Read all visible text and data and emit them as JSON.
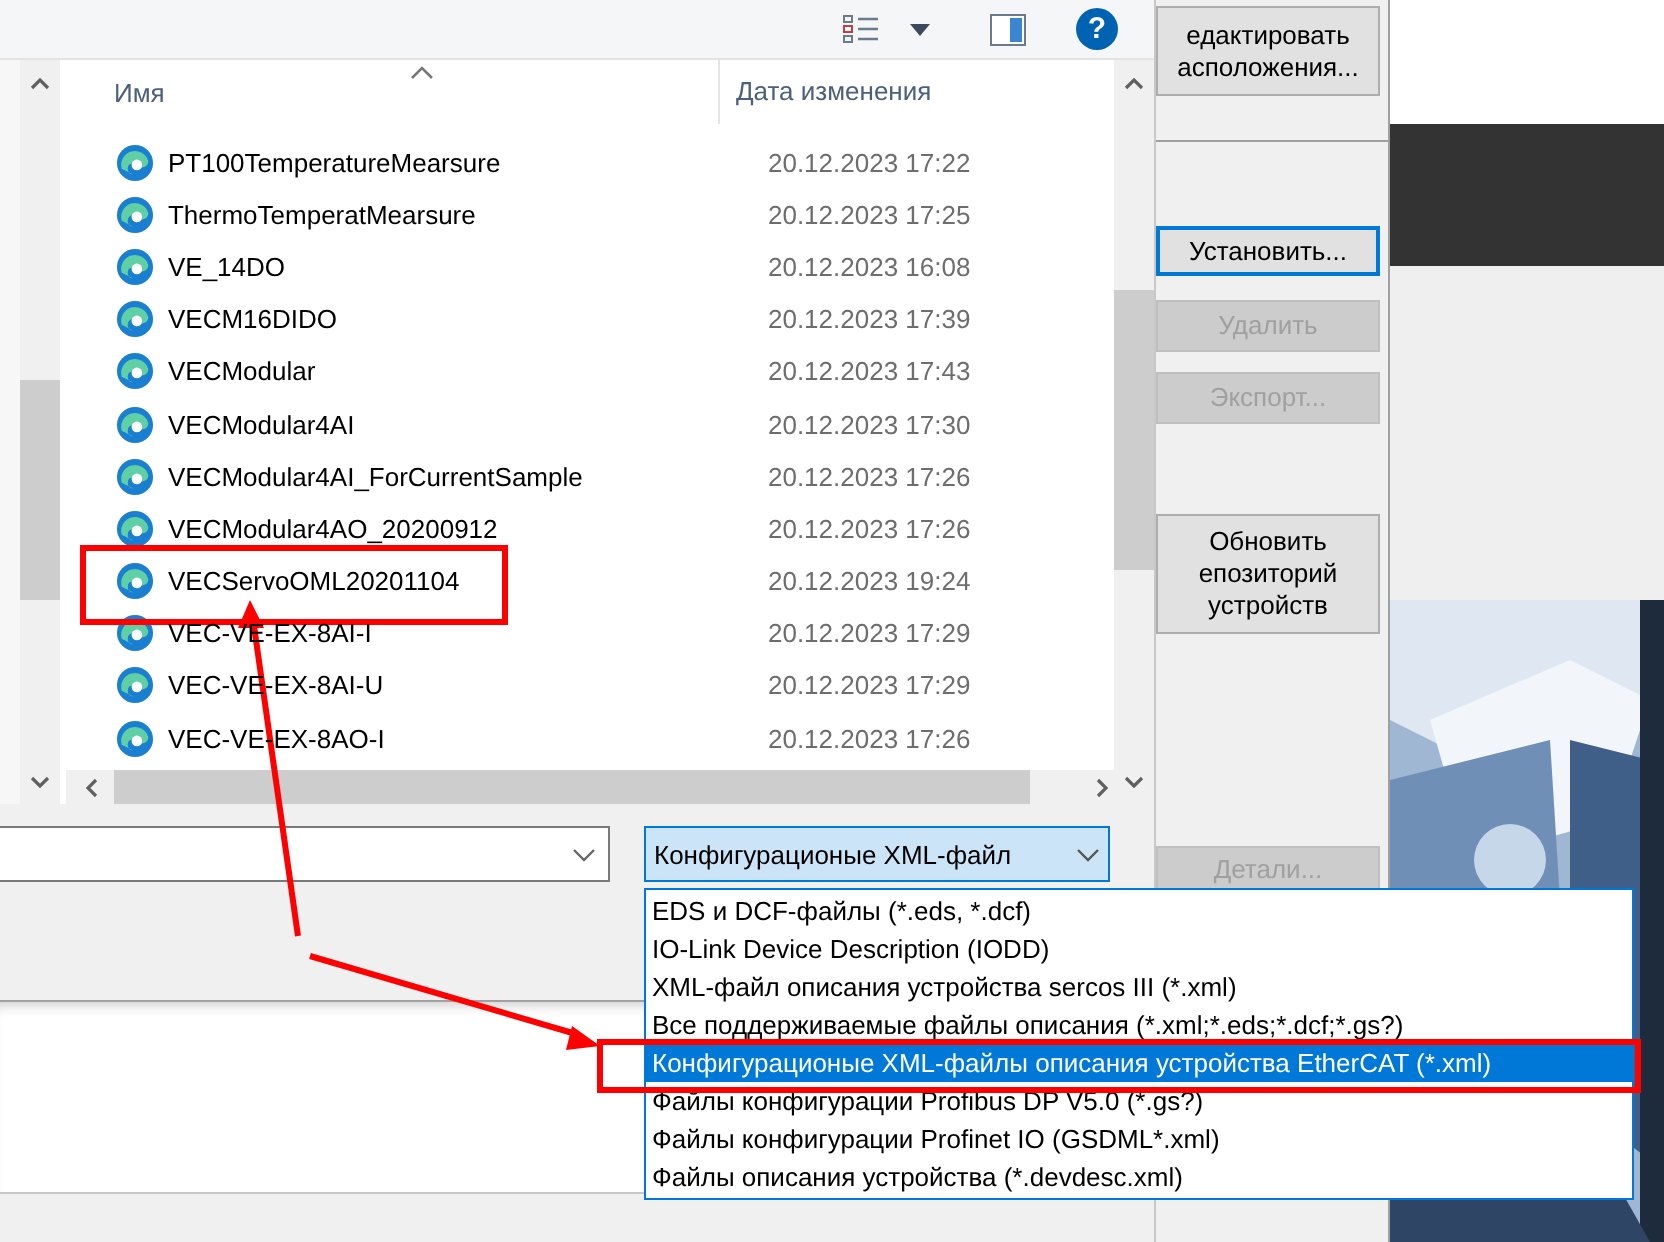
{
  "toolbar": {
    "help_label": "?"
  },
  "file_list": {
    "columns": [
      "Имя",
      "Дата изменения"
    ],
    "rows": [
      {
        "name": "PT100TemperatureMearsure",
        "date": "20.12.2023 17:22"
      },
      {
        "name": "ThermoTemperatMearsure",
        "date": "20.12.2023 17:25"
      },
      {
        "name": "VE_14DO",
        "date": "20.12.2023 16:08"
      },
      {
        "name": "VECM16DIDO",
        "date": "20.12.2023 17:39"
      },
      {
        "name": "VECModular",
        "date": "20.12.2023 17:43"
      },
      {
        "name": "VECModular4AI",
        "date": "20.12.2023 17:30"
      },
      {
        "name": "VECModular4AI_ForCurrentSample",
        "date": "20.12.2023 17:26"
      },
      {
        "name": "VECModular4AO_20200912",
        "date": "20.12.2023 17:26"
      },
      {
        "name": "VECServoOML20201104",
        "date": "20.12.2023 19:24"
      },
      {
        "name": "VEC-VE-EX-8AI-I",
        "date": "20.12.2023 17:29"
      },
      {
        "name": "VEC-VE-EX-8AI-U",
        "date": "20.12.2023 17:29"
      },
      {
        "name": "VEC-VE-EX-8AO-I",
        "date": "20.12.2023 17:26"
      }
    ]
  },
  "file_type_combo": {
    "value": "Конфигурационые  XML-файл",
    "open": true
  },
  "file_type_dropdown": {
    "items": [
      {
        "label": "EDS и DCF-файлы (*.eds, *.dcf)",
        "selected": false
      },
      {
        "label": "IO-Link Device Description (IODD)",
        "selected": false
      },
      {
        "label": "XML-файл описания устройства sercos III (*.xml)",
        "selected": false
      },
      {
        "label": "Все поддерживаемые файлы описания (*.xml;*.eds;*.dcf;*.gs?)",
        "selected": false
      },
      {
        "label": "Конфигурационые  XML-файлы описания устройства EtherCAT (*.xml)",
        "selected": true
      },
      {
        "label": "Файлы конфигурации Profibus DP V5.0 (*.gs?)",
        "selected": false
      },
      {
        "label": "Файлы конфигурации Profinet IO (GSDML*.xml)",
        "selected": false
      },
      {
        "label": "Файлы описания устройства (*.devdesc.xml)",
        "selected": false
      }
    ]
  },
  "side_panel": {
    "buttons": [
      {
        "lines": [
          "едактировать",
          "асположения..."
        ],
        "disabled": false,
        "focused": false
      },
      {
        "lines": [
          "Установить..."
        ],
        "disabled": false,
        "focused": true
      },
      {
        "lines": [
          "Удалить"
        ],
        "disabled": true,
        "focused": false
      },
      {
        "lines": [
          "Экспорт..."
        ],
        "disabled": true,
        "focused": false
      },
      {
        "lines": [
          "Обновить",
          "епозиторий",
          "устройств"
        ],
        "disabled": false,
        "focused": false
      },
      {
        "lines": [
          "Детали..."
        ],
        "disabled": true,
        "focused": false
      }
    ]
  }
}
